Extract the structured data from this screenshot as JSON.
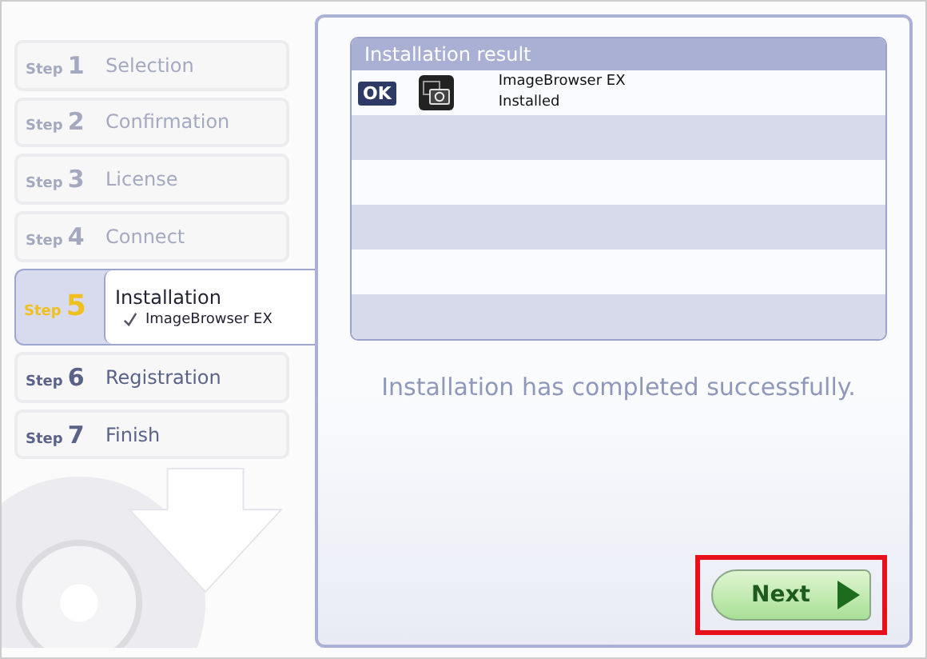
{
  "steps": [
    {
      "prefix": "Step",
      "number": "1",
      "label": "Selection",
      "completed": true,
      "selected": false
    },
    {
      "prefix": "Step",
      "number": "2",
      "label": "Confirmation",
      "completed": true,
      "selected": false
    },
    {
      "prefix": "Step",
      "number": "3",
      "label": "License",
      "completed": true,
      "selected": false
    },
    {
      "prefix": "Step",
      "number": "4",
      "label": "Connect",
      "completed": true,
      "selected": false
    },
    {
      "prefix": "Step",
      "number": "5",
      "label": "Installation",
      "completed": false,
      "selected": true,
      "items": [
        "ImageBrowser EX"
      ]
    },
    {
      "prefix": "Step",
      "number": "6",
      "label": "Registration",
      "completed": false,
      "selected": false
    },
    {
      "prefix": "Step",
      "number": "7",
      "label": "Finish",
      "completed": false,
      "selected": false
    }
  ],
  "result_table": {
    "title": "Installation result",
    "rows": [
      {
        "status": "OK",
        "name": "ImageBrowser EX",
        "state": "Installed"
      }
    ]
  },
  "message": "Installation has completed successfully.",
  "next_button": {
    "label": "Next",
    "highlighted": true
  }
}
